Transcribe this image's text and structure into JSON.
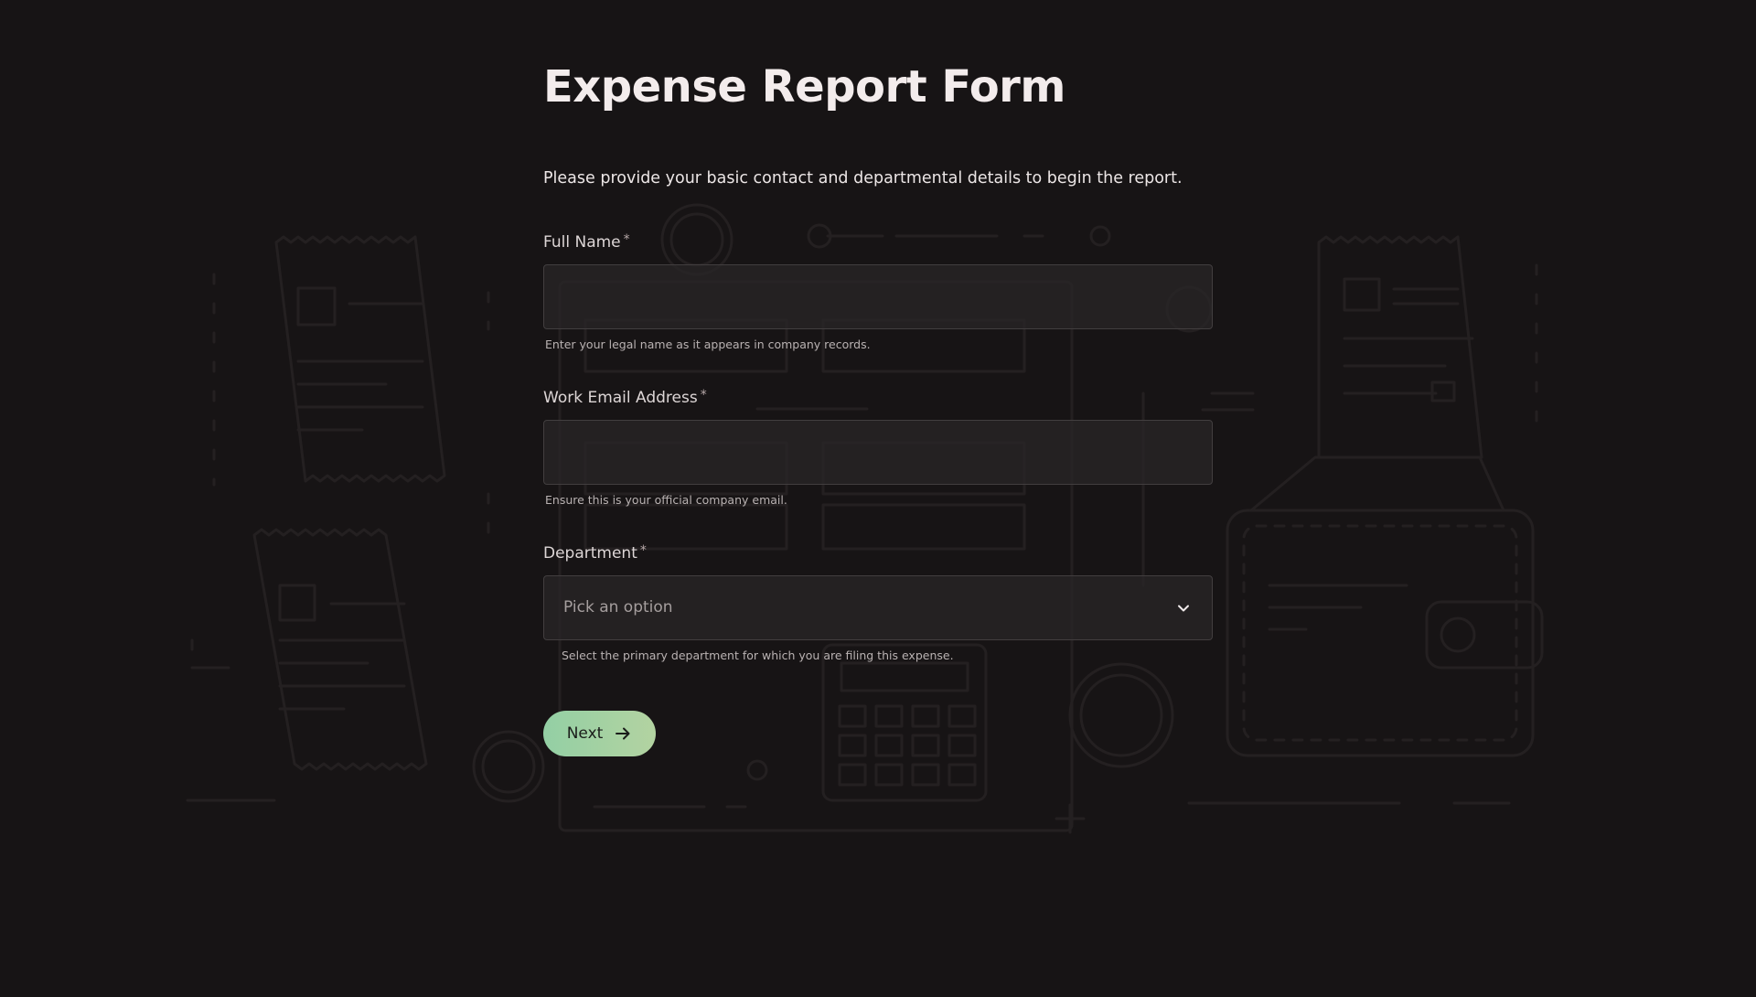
{
  "form": {
    "title": "Expense Report Form",
    "intro": "Please provide your basic contact and departmental details to begin the report.",
    "required_mark": "*",
    "fields": [
      {
        "label": "Full Name",
        "value": "",
        "placeholder": "",
        "helper": "Enter your legal name as it appears in company records."
      },
      {
        "label": "Work Email Address",
        "value": "",
        "placeholder": "",
        "helper": "Ensure this is your official company email."
      },
      {
        "label": "Department",
        "selected": "Pick an option",
        "helper": "Select the primary department for which you are filing this expense."
      }
    ],
    "next_label": "Next"
  },
  "icons": {
    "select_chevron": "chevron-down-icon",
    "next_arrow": "arrow-right-icon",
    "background": "expense-illustration"
  },
  "colors": {
    "background": "#171415",
    "button_gradient_start": "#93cfa4",
    "button_gradient_end": "#b3d3a1"
  }
}
